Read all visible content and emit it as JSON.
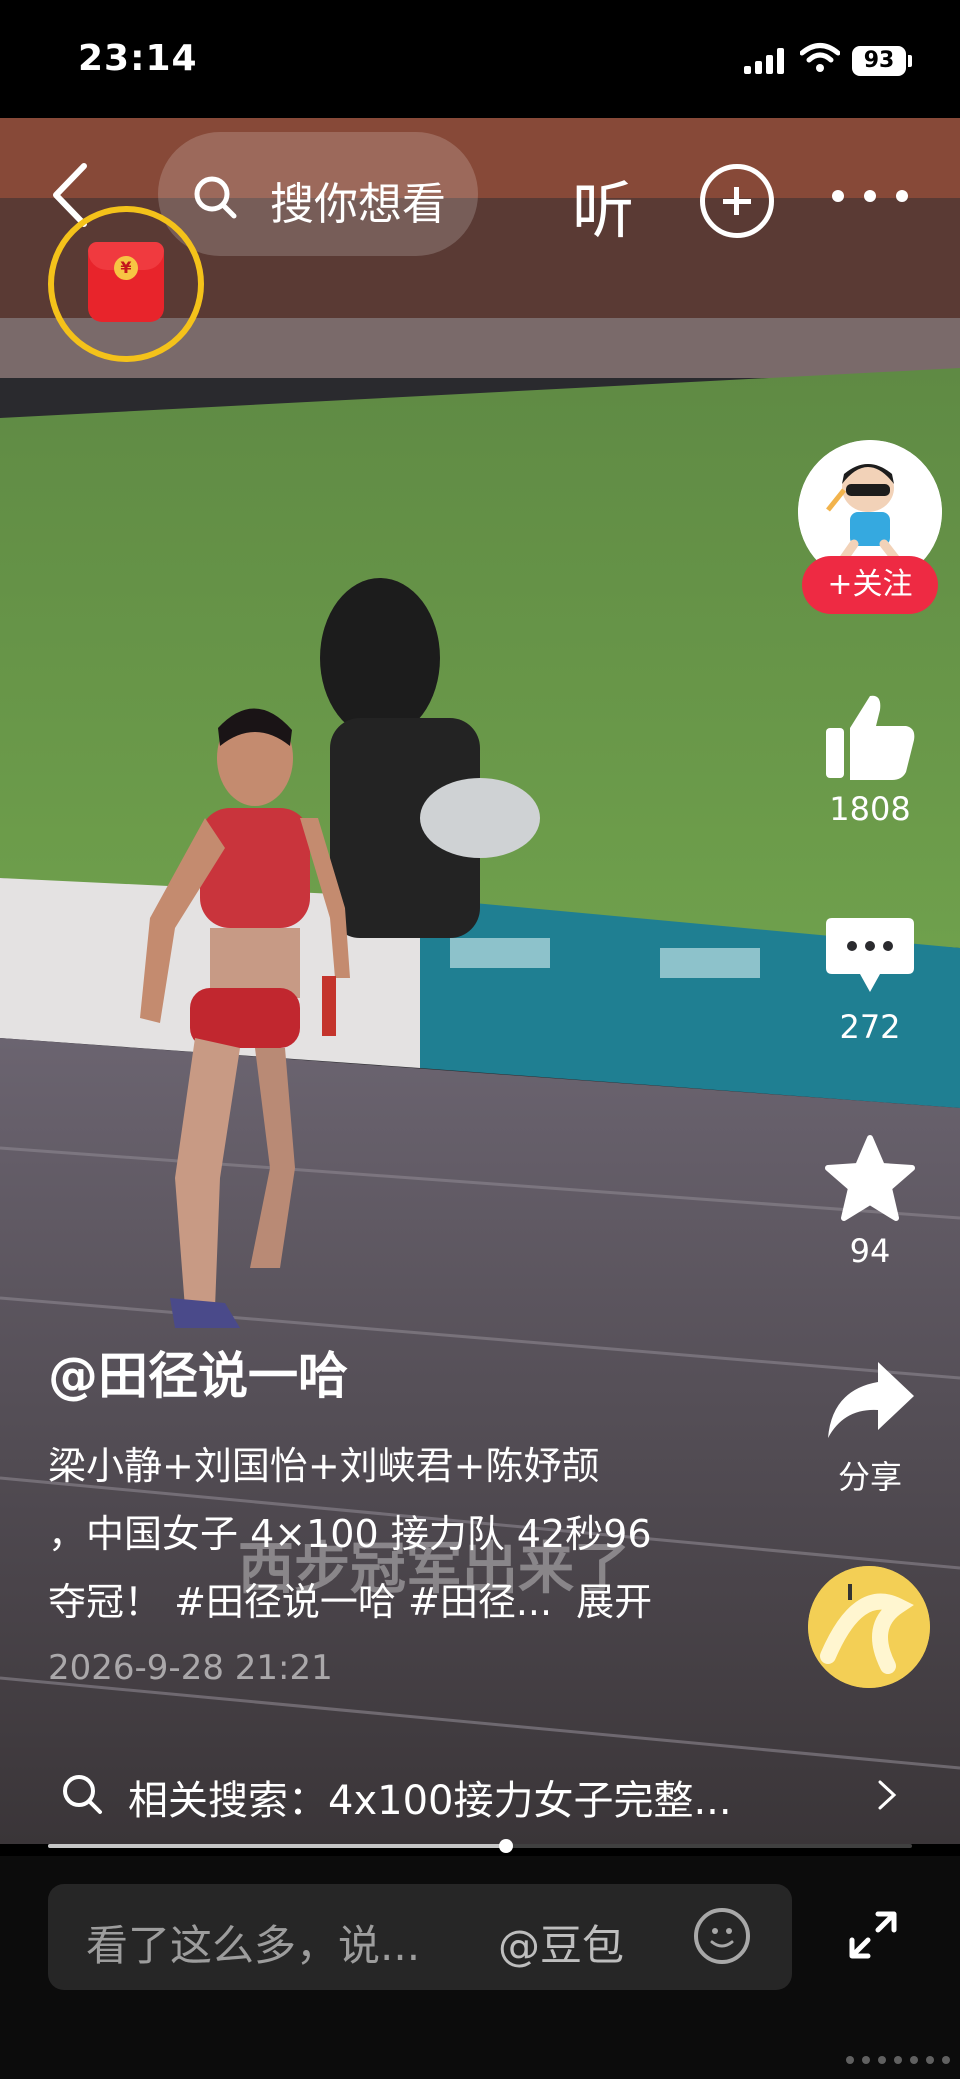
{
  "status_bar": {
    "time": "23:14",
    "battery": "93"
  },
  "top_bar": {
    "search_placeholder": "搜你想看",
    "listen_label": "听"
  },
  "author": {
    "follow_label": "+关注",
    "handle": "@田径说一哈"
  },
  "actions": {
    "likes": "1808",
    "comments": "272",
    "favorites": "94",
    "share_label": "分享"
  },
  "caption": {
    "line1": "梁小静+刘国怡+刘峡君+陈妤颉",
    "line2": "，中国女子 4×100 接力队 42秒96",
    "line3": "夺冠！ #田径说一哈 #田径...",
    "expand_label": "展开",
    "date": "2026-9-28 21:21"
  },
  "related_search": {
    "text": "相关搜索：4x100接力女子完整..."
  },
  "progress": {
    "fraction": 0.53
  },
  "bottom_bar": {
    "comment_placeholder": "看了这么多，说...",
    "mention": "@豆包"
  },
  "colors": {
    "follow_red": "#ee2a43",
    "red_packet": "#e8242b",
    "ring_yellow": "#f4c21a"
  },
  "icons": [
    "back-icon",
    "search-icon",
    "add-icon",
    "more-icon",
    "red-packet-icon",
    "like-icon",
    "comment-icon",
    "star-icon",
    "share-icon",
    "music-disc-icon",
    "emoji-icon",
    "fullscreen-icon"
  ]
}
